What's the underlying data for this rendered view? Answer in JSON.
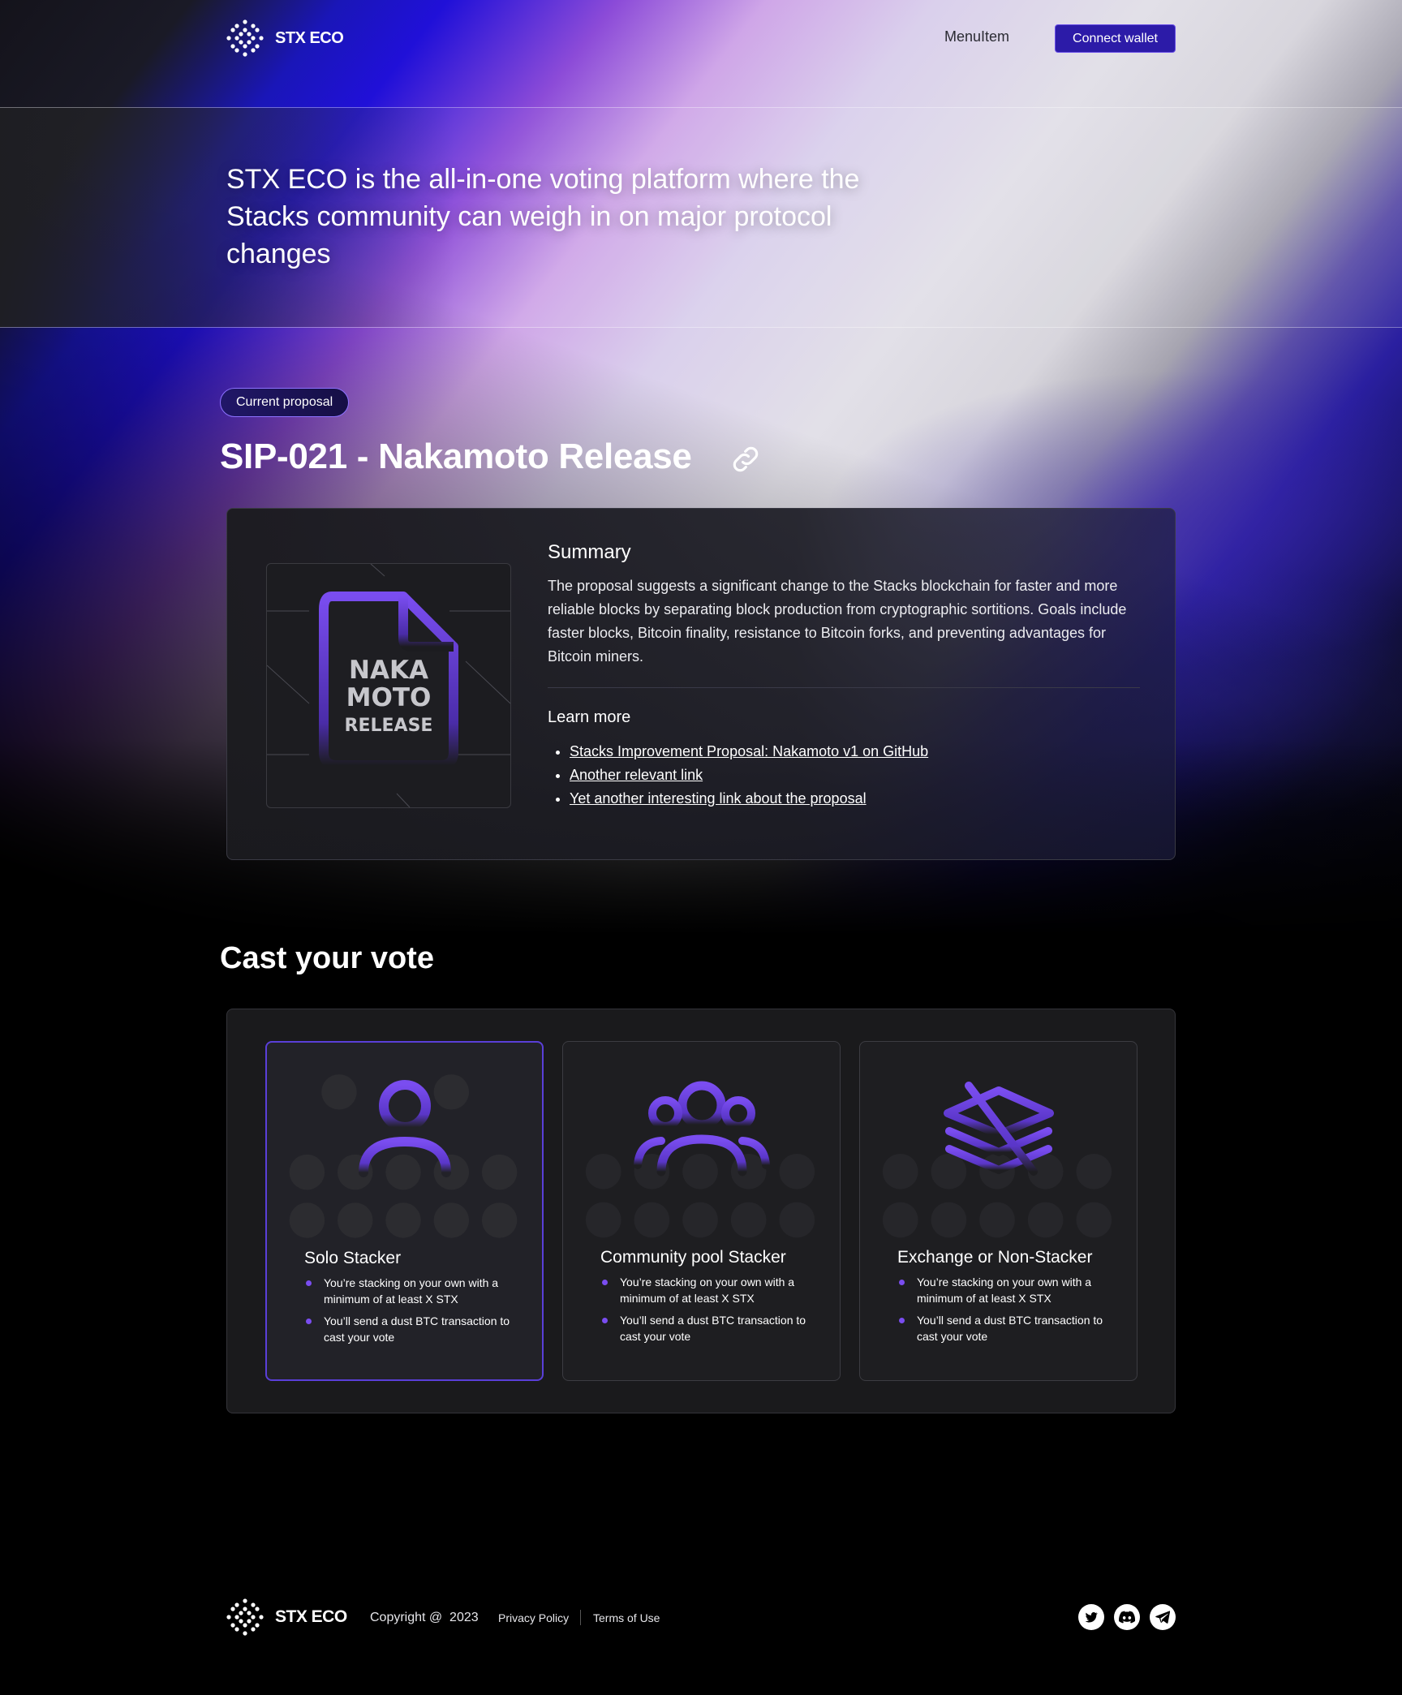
{
  "brand": {
    "name": "STX ECO"
  },
  "nav": {
    "menu_item": "MenuItem",
    "connect_wallet": "Connect wallet"
  },
  "hero": {
    "tagline": "STX ECO is the all-in-one voting platform where the Stacks community can weigh in on major protocol changes"
  },
  "proposal": {
    "badge": "Current proposal",
    "title": "SIP-021 - Nakamoto Release",
    "art_lines": [
      "NAKA",
      "MOTO",
      "RELEASE"
    ],
    "summary_heading": "Summary",
    "summary_text": "The proposal suggests a significant change to the Stacks blockchain for faster and more reliable blocks by separating block production from cryptographic sortitions. Goals include faster blocks, Bitcoin finality, resistance to Bitcoin forks, and preventing advantages for Bitcoin miners.",
    "learn_more_heading": "Learn more",
    "links": [
      "Stacks Improvement Proposal: Nakamoto v1 on GitHub",
      "Another relevant link",
      "Yet another interesting link about the proposal"
    ]
  },
  "vote": {
    "heading": "Cast your vote",
    "options": [
      {
        "name": "Solo Stacker",
        "icon": "user-icon",
        "selected": true,
        "bullets": [
          "You’re stacking on your own with a minimum of at least X STX",
          "You’ll send a dust BTC transaction to cast your vote"
        ]
      },
      {
        "name": "Community pool Stacker",
        "icon": "users-group-icon",
        "selected": false,
        "bullets": [
          "You’re stacking on your own with a minimum of at least X STX",
          "You’ll send a dust BTC transaction to cast your vote"
        ]
      },
      {
        "name": "Exchange or Non-Stacker",
        "icon": "layers-off-icon",
        "selected": false,
        "bullets": [
          "You’re stacking on your own with a minimum of at least X STX",
          "You’ll send a dust BTC transaction to cast your vote"
        ]
      }
    ]
  },
  "footer": {
    "brand": "STX ECO",
    "copyright": "Copyright @  2023",
    "privacy": "Privacy Policy",
    "terms": "Terms of Use",
    "socials": [
      "twitter-icon",
      "discord-icon",
      "telegram-icon"
    ]
  },
  "colors": {
    "accent": "#7A4DF0",
    "button": "#2C1BA8",
    "panel": "#1A1A1C"
  }
}
